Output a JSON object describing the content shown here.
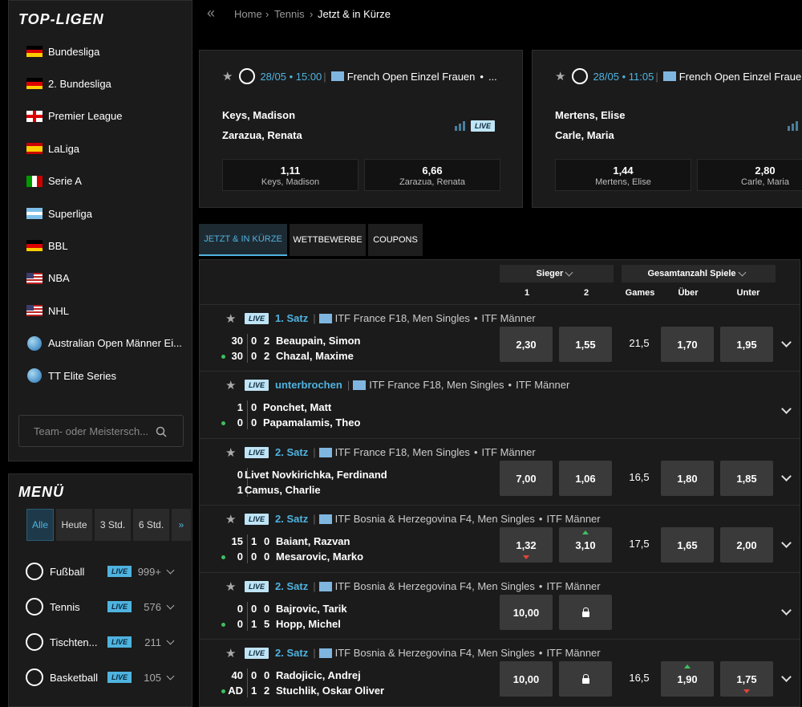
{
  "sidebar": {
    "top_title": "TOP-LIGEN",
    "leagues": [
      {
        "label": "Bundesliga",
        "flag": "de"
      },
      {
        "label": "2. Bundesliga",
        "flag": "de"
      },
      {
        "label": "Premier League",
        "flag": "en"
      },
      {
        "label": "LaLiga",
        "flag": "es"
      },
      {
        "label": "Serie A",
        "flag": "it"
      },
      {
        "label": "Superliga",
        "flag": "ar"
      },
      {
        "label": "BBL",
        "flag": "de"
      },
      {
        "label": "NBA",
        "flag": "us"
      },
      {
        "label": "NHL",
        "flag": "us"
      },
      {
        "label": "Australian Open Männer Ei...",
        "flag": "globe"
      },
      {
        "label": "TT Elite Series",
        "flag": "globe"
      }
    ],
    "search_placeholder": "Team- oder Meistersch...",
    "menu_title": "MENÜ",
    "filters": [
      "Alle",
      "Heute",
      "3 Std.",
      "6 Std."
    ],
    "sports": [
      {
        "label": "Fußball",
        "live": "LIVE",
        "count": "999+"
      },
      {
        "label": "Tennis",
        "live": "LIVE",
        "count": "576"
      },
      {
        "label": "Tischten...",
        "live": "LIVE",
        "count": "211"
      },
      {
        "label": "Basketball",
        "live": "LIVE",
        "count": "105"
      }
    ]
  },
  "breadcrumb": {
    "home": "Home",
    "tennis": "Tennis",
    "current": "Jetzt & in Kürze"
  },
  "cards": [
    {
      "date": "28/05 • 15:00",
      "competition": "French Open Einzel Frauen",
      "dot": "•",
      "ellipsis": "...",
      "p1": "Keys, Madison",
      "p2": "Zarazua, Renata",
      "live": "LIVE",
      "odd1": "1,11",
      "odd1_name": "Keys, Madison",
      "odd2": "6,66",
      "odd2_name": "Zarazua, Renata"
    },
    {
      "date": "28/05 • 11:05",
      "competition": "French Open Einzel Fraue",
      "p1": "Mertens, Elise",
      "p2": "Carle, Maria",
      "odd1": "1,44",
      "odd1_name": "Mertens, Elise",
      "odd2": "2,80",
      "odd2_name": "Carle, Maria"
    }
  ],
  "tabs": [
    "JETZT & IN KÜRZE",
    "WETTBEWERBE",
    "COUPONS"
  ],
  "table_header": {
    "sieger": "Sieger",
    "gesamt": "Gesamtanzahl Spiele",
    "c1": "1",
    "c2": "2",
    "games": "Games",
    "ueber": "Über",
    "unter": "Unter"
  },
  "matches": [
    {
      "live": "LIVE",
      "phase": "1. Satz",
      "league": "ITF France F18, Men Singles",
      "tour": "ITF Männer",
      "p1_pts": "30",
      "p1_g": "0",
      "p1_s": "2",
      "p1": "Beaupain, Simon",
      "p2_pts": "30",
      "p2_g": "0",
      "p2_s": "2",
      "p2": "Chazal, Maxime",
      "o1": "2,30",
      "o2": "1,55",
      "games": "21,5",
      "over": "1,70",
      "under": "1,95"
    },
    {
      "live": "LIVE",
      "phase": "unterbrochen",
      "league": "ITF France F18, Men Singles",
      "tour": "ITF Männer",
      "p1_pts": "1",
      "p1_g": "0",
      "p1_s": "",
      "p1": "Ponchet, Matt",
      "p2_pts": "0",
      "p2_g": "0",
      "p2_s": "",
      "p2": "Papamalamis, Theo",
      "o1": "",
      "o2": "",
      "games": "",
      "over": "",
      "under": ""
    },
    {
      "live": "LIVE",
      "phase": "2. Satz",
      "league": "ITF France F18, Men Singles",
      "tour": "ITF Männer",
      "p1_pts": "0",
      "p1_g": "",
      "p1_s": "",
      "p1": "Livet Novkirichka, Ferdinand",
      "p2_pts": "1",
      "p2_g": "",
      "p2_s": "",
      "p2": "Camus, Charlie",
      "o1": "7,00",
      "o2": "1,06",
      "games": "16,5",
      "over": "1,80",
      "under": "1,85"
    },
    {
      "live": "LIVE",
      "phase": "2. Satz",
      "league": "ITF Bosnia & Herzegovina F4, Men Singles",
      "tour": "ITF Männer",
      "p1_pts": "15",
      "p1_g": "1",
      "p1_s": "0",
      "p1": "Baiant, Razvan",
      "p2_pts": "0",
      "p2_g": "0",
      "p2_s": "0",
      "p2": "Mesarovic, Marko",
      "o1": "1,32",
      "o2": "3,10",
      "games": "17,5",
      "over": "1,65",
      "under": "2,00"
    },
    {
      "live": "LIVE",
      "phase": "2. Satz",
      "league": "ITF Bosnia & Herzegovina F4, Men Singles",
      "tour": "ITF Männer",
      "p1_pts": "0",
      "p1_g": "0",
      "p1_s": "0",
      "p1": "Bajrovic, Tarik",
      "p2_pts": "0",
      "p2_g": "1",
      "p2_s": "5",
      "p2": "Hopp, Michel",
      "o1": "10,00",
      "o2": "",
      "games": "",
      "over": "",
      "under": ""
    },
    {
      "live": "LIVE",
      "phase": "2. Satz",
      "league": "ITF Bosnia & Herzegovina F4, Men Singles",
      "tour": "ITF Männer",
      "p1_pts": "40",
      "p1_g": "0",
      "p1_s": "0",
      "p1": "Radojicic, Andrej",
      "p2_pts": "AD",
      "p2_g": "1",
      "p2_s": "2",
      "p2": "Stuchlik, Oskar Oliver",
      "o1": "10,00",
      "o2": "",
      "games": "16,5",
      "over": "1,90",
      "under": "1,75"
    }
  ],
  "colors": {
    "accent": "#4fb3e0",
    "live_badge": "#bfe4f5",
    "up": "#3fbf5f",
    "down": "#e0453a"
  }
}
